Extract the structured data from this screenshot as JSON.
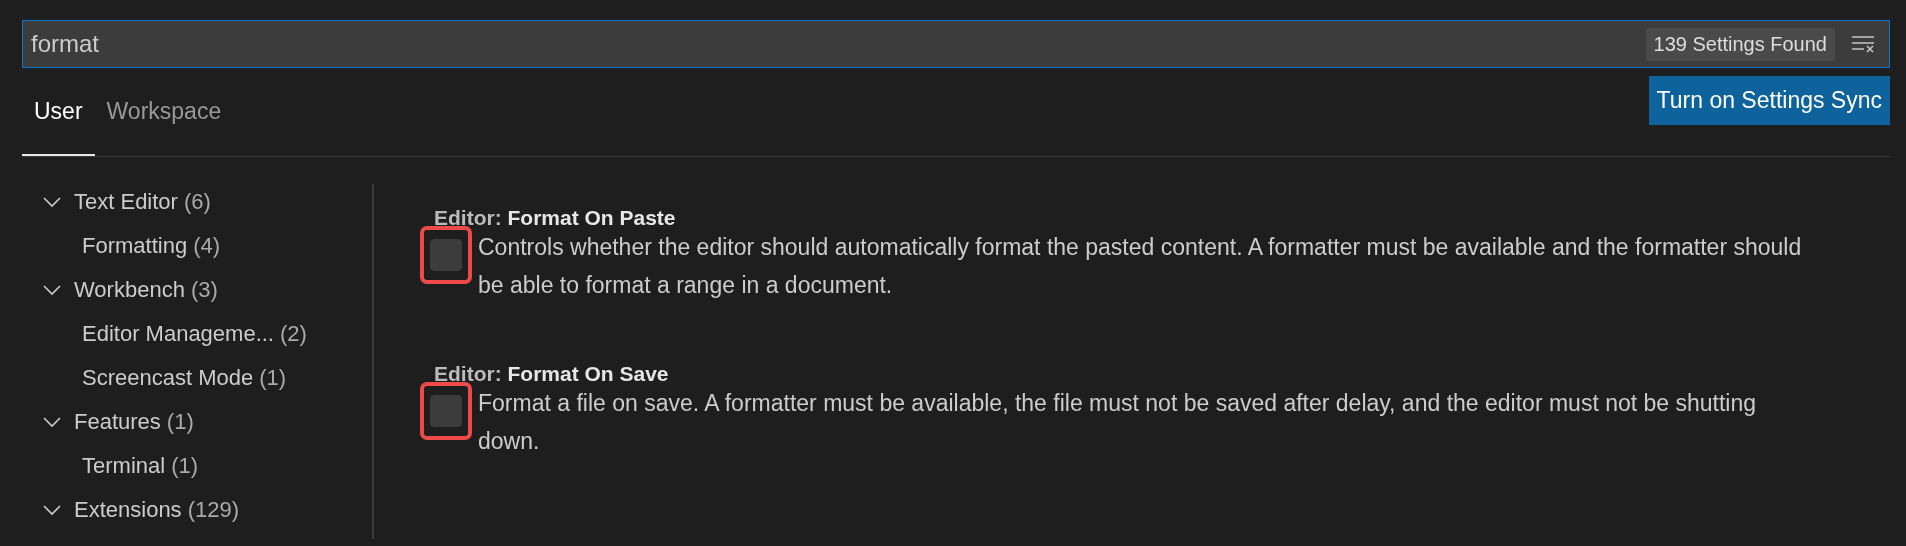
{
  "search": {
    "value": "format",
    "result_count": "139 Settings Found"
  },
  "tabs": [
    {
      "label": "User",
      "selected": true
    },
    {
      "label": "Workspace",
      "selected": false
    }
  ],
  "sync_button": "Turn on Settings Sync",
  "toc": [
    {
      "label": "Text Editor",
      "count": "(6)",
      "expanded": true,
      "children": [
        {
          "label": "Formatting",
          "count": "(4)"
        }
      ]
    },
    {
      "label": "Workbench",
      "count": "(3)",
      "expanded": true,
      "children": [
        {
          "label": "Editor Manageme...",
          "count": "(2)"
        },
        {
          "label": "Screencast Mode",
          "count": "(1)"
        }
      ]
    },
    {
      "label": "Features",
      "count": "(1)",
      "expanded": true,
      "children": [
        {
          "label": "Terminal",
          "count": "(1)"
        }
      ]
    },
    {
      "label": "Extensions",
      "count": "(129)",
      "expanded": true
    }
  ],
  "settings": [
    {
      "title": "Editor: **Format On Paste**",
      "checked": false,
      "highlighted": true,
      "description": "Controls whether the editor should automatically format the pasted content. A formatter must be available and the formatter should be able to format a range in a document."
    },
    {
      "title": "Editor: **Format On Save**",
      "checked": false,
      "highlighted": true,
      "description": "Format a file on save. A formatter must be available, the file must not be saved after delay, and the editor must not be shutting down."
    }
  ]
}
